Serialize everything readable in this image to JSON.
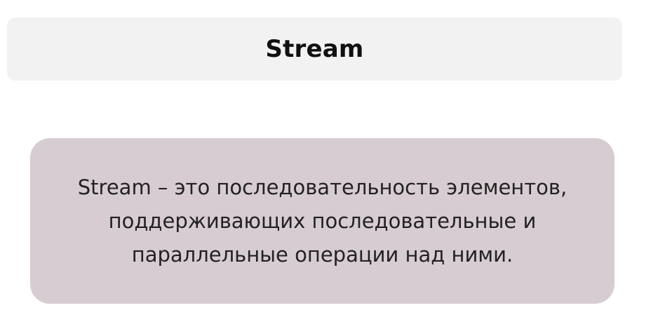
{
  "slide": {
    "title": "Stream",
    "definition_lines": [
      "Stream – это последовательность элементов,",
      "поддерживающих последовательные и",
      "параллельные операции над ними."
    ]
  },
  "colors": {
    "title_bar_background": "#f3f2f3",
    "definition_box_background": "#d8ccd3",
    "text": "#222222"
  }
}
